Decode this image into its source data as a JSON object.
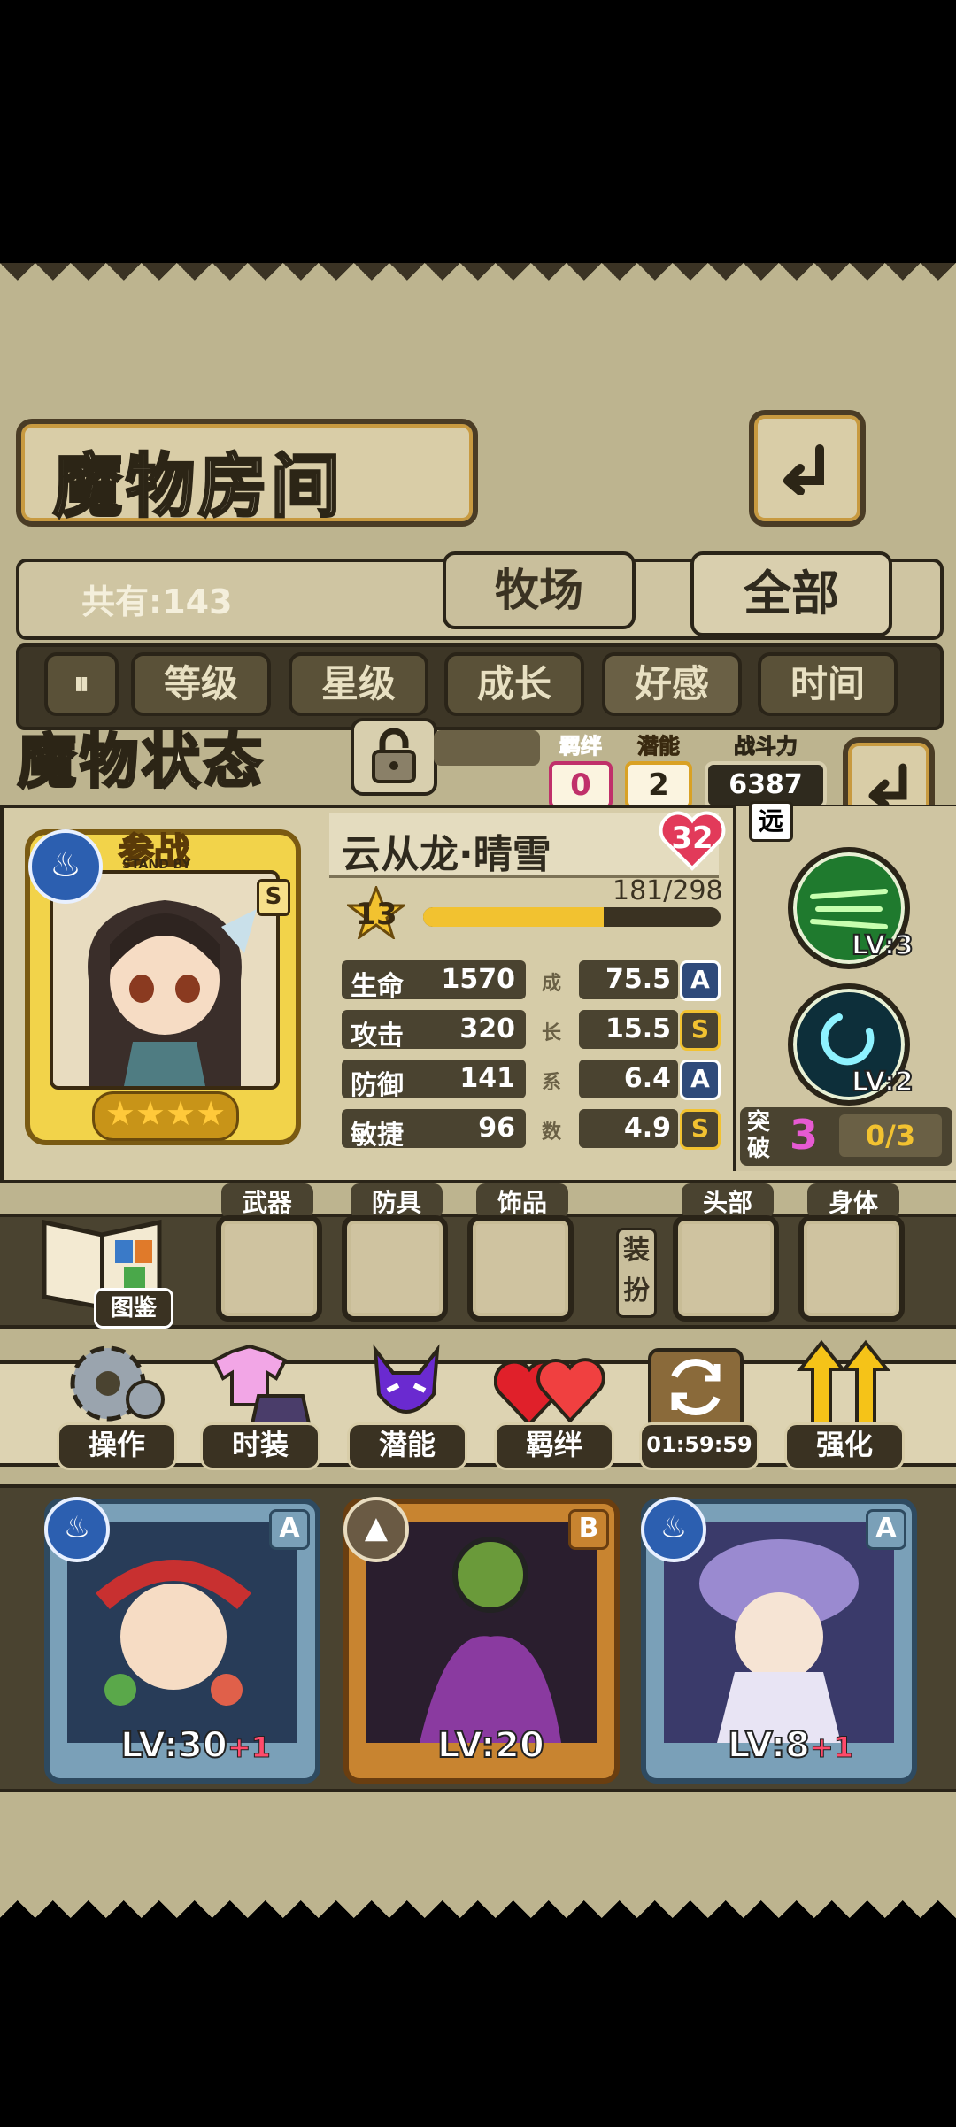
{
  "header": {
    "title": "魔物房间",
    "back_icon": "back-arrow-icon"
  },
  "filter_bar": {
    "count_text": "共有:143",
    "tabs": [
      {
        "label": "牧场"
      },
      {
        "label": "全部"
      }
    ]
  },
  "sort_tabs": [
    "等级",
    "星级",
    "成长",
    "好感",
    "时间"
  ],
  "status": {
    "title": "魔物状态",
    "bond_label": "羁绊",
    "bond_value": "0",
    "potential_label": "潜能",
    "potential_value": "2",
    "power_label": "战斗力",
    "power_value": "6387"
  },
  "monster": {
    "name": "云从龙·晴雪",
    "badge_level": "32",
    "deploy_label": "参战",
    "standby_label": "STAND BY",
    "rank": "S",
    "stars": 4,
    "level": "13",
    "exp_text": "181/298",
    "exp_fraction": 0.607,
    "stats": [
      {
        "label": "生命",
        "value": "1570",
        "growth": "75.5",
        "grade": "A"
      },
      {
        "label": "攻击",
        "value": "320",
        "growth": "15.5",
        "grade": "S"
      },
      {
        "label": "防御",
        "value": "141",
        "growth": "6.4",
        "grade": "A"
      },
      {
        "label": "敏捷",
        "value": "96",
        "growth": "4.9",
        "grade": "S"
      }
    ],
    "growth_label": [
      "成",
      "长",
      "系",
      "数"
    ]
  },
  "skills": {
    "range_label": "远",
    "items": [
      {
        "level": "LV:3"
      },
      {
        "level": "LV:2"
      }
    ],
    "breakthrough_label": "突破",
    "breakthrough_value": "3",
    "breakthrough_progress": "0/3"
  },
  "equipment": {
    "codex_label": "图鉴",
    "slots": [
      "武器",
      "防具",
      "饰品"
    ],
    "dress_label": "装扮",
    "dress_slots": [
      "头部",
      "身体"
    ]
  },
  "menu": [
    {
      "label": "操作"
    },
    {
      "label": "时装"
    },
    {
      "label": "潜能"
    },
    {
      "label": "羁绊"
    },
    {
      "label": "01:59:59"
    },
    {
      "label": "强化"
    }
  ],
  "cards": [
    {
      "level": "LV:30",
      "plus": "+1",
      "rank": "A"
    },
    {
      "level": "LV:20",
      "plus": "",
      "rank": "B"
    },
    {
      "level": "LV:8",
      "plus": "+1",
      "rank": "A"
    }
  ],
  "colors": {
    "gold": "#f2c230",
    "accent_pink": "#e23a6a",
    "panel_dark": "#4a4330",
    "panel_light": "#d6cca8"
  }
}
